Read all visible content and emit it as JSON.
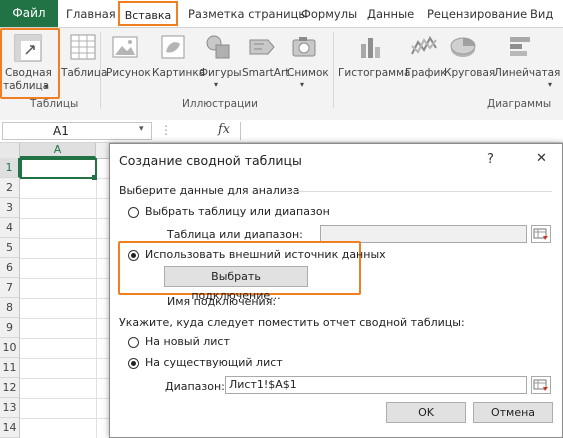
{
  "tabs": {
    "file": "Файл",
    "home": "Главная",
    "insert": "Вставка",
    "page_layout": "Разметка страницы",
    "formulas": "Формулы",
    "data": "Данные",
    "review": "Рецензирование",
    "view": "Вид"
  },
  "ribbon": {
    "tables": {
      "pivot_line1": "Сводная",
      "pivot_line2": "таблица",
      "table": "Таблица",
      "group": "Таблицы"
    },
    "illustrations": {
      "picture": "Рисунок",
      "clipart": "Картинка",
      "shapes": "Фигуры",
      "smartart": "SmartArt",
      "screenshot": "Снимок",
      "group": "Иллюстрации"
    },
    "charts": {
      "histogram": "Гистограмма",
      "line": "График",
      "pie": "Круговая",
      "bar": "Линейчатая",
      "group": "Диаграммы"
    }
  },
  "formula_bar": {
    "name_box": "A1",
    "fx": "fx"
  },
  "grid": {
    "col_a": "A",
    "rows": [
      "1",
      "2",
      "3",
      "4",
      "5",
      "6",
      "7",
      "8",
      "9",
      "10",
      "11",
      "12",
      "13",
      "14"
    ]
  },
  "dialog": {
    "title": "Создание сводной таблицы",
    "help": "?",
    "close": "✕",
    "section1": "Выберите данные для анализа",
    "opt_select_table": "Выбрать таблицу или диапазон",
    "table_range_label": "Таблица или диапазон:",
    "opt_external": "Использовать внешний источник данных",
    "choose_connection": "Выбрать подключение...",
    "connection_name_label": "Имя подключения:",
    "section2": "Укажите, куда следует поместить отчет сводной таблицы:",
    "opt_new_sheet": "На новый лист",
    "opt_existing_sheet": "На существующий лист",
    "range_label": "Диапазон:",
    "range_value": "Лист1!$A$1",
    "ok": "OK",
    "cancel": "Отмена"
  },
  "colors": {
    "file_tab": "#217346",
    "highlight": "#f07f21",
    "ribbon_bg": "#f3f3f3"
  }
}
